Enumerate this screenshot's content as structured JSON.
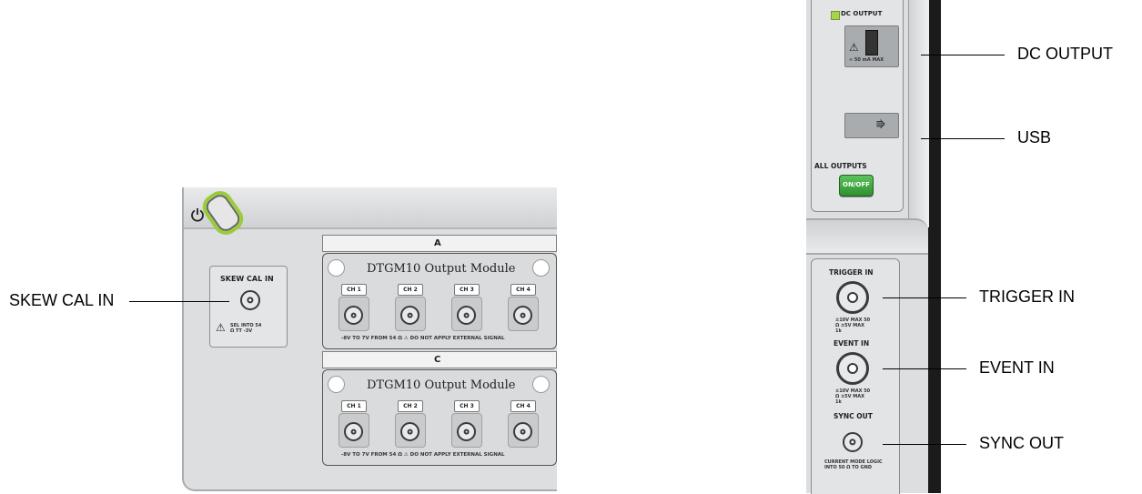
{
  "callouts": {
    "skew_cal_in": "SKEW CAL IN",
    "dc_output": "DC OUTPUT",
    "usb": "USB",
    "trigger_in": "TRIGGER IN",
    "event_in": "EVENT IN",
    "sync_out": "SYNC OUT"
  },
  "left_panel": {
    "skew_cal_label": "SKEW CAL IN",
    "skew_cal_warning": "SEL INTO 54 Ω TT -3V",
    "slot_a": {
      "slot_label": "A",
      "module_title": "DTGM10 Output Module",
      "channels": [
        "CH 1",
        "CH 2",
        "CH 3",
        "CH 4"
      ],
      "spec_text": "-8V TO 7V FROM 54 Ω  ⚠ DO NOT APPLY EXTERNAL SIGNAL"
    },
    "slot_c": {
      "slot_label": "C",
      "module_title": "DTGM10 Output Module",
      "channels": [
        "CH 1",
        "CH 2",
        "CH 3",
        "CH 4"
      ],
      "spec_text": "-8V TO 7V FROM 54 Ω  ⚠ DO NOT APPLY EXTERNAL SIGNAL"
    }
  },
  "right_panel": {
    "dc_output_label": "DC OUTPUT",
    "dc_output_spec": "≈ 50 mA MAX",
    "all_outputs_label": "ALL OUTPUTS",
    "on_off_button": "ON/OFF",
    "trigger_in_label": "TRIGGER IN",
    "trigger_in_spec": "±10V MAX 50 Ω ±5V MAX 1k",
    "event_in_label": "EVENT IN",
    "event_in_spec": "±10V MAX 50 Ω ±5V MAX 1k",
    "sync_out_label": "SYNC OUT",
    "sync_out_spec": "CURRENT MODE LOGIC INTO 50 Ω TO GND"
  },
  "colors": {
    "panel_gray": "#dcdedf",
    "panel_dark_edge": "#1b1b1b",
    "power_ring_green": "#9acb3c",
    "on_off_green": "#3aa43a",
    "dc_led_green": "#a6d44a"
  }
}
